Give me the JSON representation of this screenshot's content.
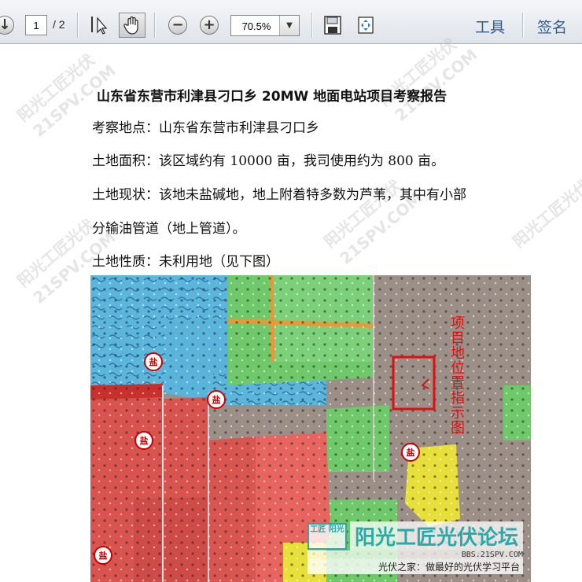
{
  "toolbar": {
    "page_current": "1",
    "page_total": "/ 2",
    "zoom": "70.5%",
    "tools_label": "工具",
    "sign_label": "签名"
  },
  "document": {
    "title": "山东省东营市利津县刁口乡 20MW 地面电站项目考察报告",
    "lines": [
      "考察地点：山东省东营市利津县刁口乡",
      "土地面积：该区域约有 10000 亩，我司使用约为 800 亩。",
      "土地现状：该地未盐碱地，地上附着特多数为芦苇，其中有小部",
      "分输油管道（地上管道）。",
      "土地性质：未利用地（见下图）"
    ],
    "map": {
      "annotation": "项目地位置指示图",
      "salt_marks": [
        "盐",
        "盐",
        "盐",
        "盐",
        "盐"
      ]
    }
  },
  "watermark": {
    "text_a": "阳光工匠光伏",
    "text_b": "21SPV.COM",
    "logo_badge": "工匠 阳光",
    "logo_main": "阳光工匠光伏论坛",
    "logo_url": "BBS.21SPV.COM",
    "logo_tagline": "光伏之家：做最好的光伏学习平台"
  },
  "colors": {
    "map_red": "#d9534f",
    "map_green": "#6fc96b",
    "map_blue": "#5bb6dd",
    "map_yellow": "#e8e03a",
    "annotation_red": "#e01010"
  }
}
